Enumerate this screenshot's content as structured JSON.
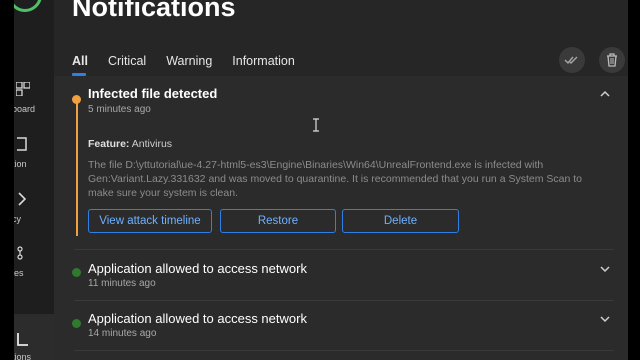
{
  "sidebar": {
    "items": [
      {
        "label": "board",
        "icon": "dashboard-icon"
      },
      {
        "label": "tion",
        "icon": "protection-icon"
      },
      {
        "label": "cy",
        "icon": "privacy-icon"
      },
      {
        "label": "ies",
        "icon": "utilities-icon"
      },
      {
        "label": "tions",
        "icon": "notifications-icon"
      }
    ]
  },
  "header": {
    "title": "Notifications"
  },
  "tabs": [
    "All",
    "Critical",
    "Warning",
    "Information"
  ],
  "toolbar": {
    "mark_read_icon": "double-check-icon",
    "delete_icon": "trash-icon"
  },
  "notifications": [
    {
      "title": "Infected file detected",
      "time": "5 minutes ago",
      "feature_label": "Feature:",
      "feature_value": "Antivirus",
      "description": "The file D:\\yttutorial\\ue-4.27-html5-es3\\Engine\\Binaries\\Win64\\UnrealFrontend.exe is infected with Gen:Variant.Lazy.331632 and was moved to quarantine. It is recommended that you run a System Scan to make sure your system is clean.",
      "actions": [
        "View attack timeline",
        "Restore",
        "Delete"
      ],
      "status_color": "#f0a040"
    },
    {
      "title": "Application allowed to access network",
      "time": "11 minutes ago",
      "status_color": "#2f7a2f"
    },
    {
      "title": "Application allowed to access network",
      "time": "14 minutes ago",
      "status_color": "#2f7a2f"
    }
  ]
}
